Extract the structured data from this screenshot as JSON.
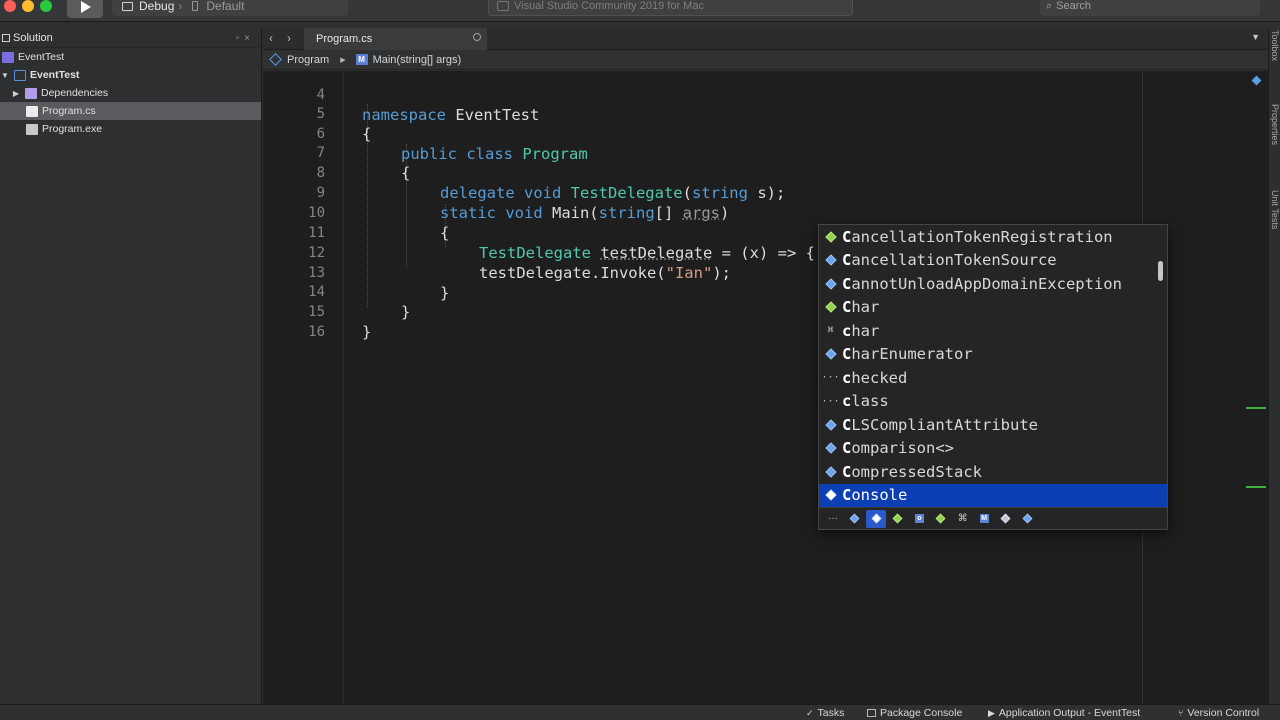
{
  "titlebar": {
    "configuration": "Debug",
    "target": "Default",
    "status_text": "Visual Studio Community 2019 for Mac",
    "search_placeholder": "Search"
  },
  "solution_pad": {
    "title": "Solution",
    "items": [
      {
        "label": "EventTest",
        "icon": "solution-icon"
      },
      {
        "label": "EventTest",
        "icon": "project-icon"
      },
      {
        "label": "Dependencies",
        "icon": "folder-icon"
      },
      {
        "label": "Program.cs",
        "icon": "csharp-file-icon",
        "selected": true
      },
      {
        "label": "Program.exe",
        "icon": "file-icon"
      }
    ]
  },
  "editor": {
    "tab_label": "Program.cs",
    "breadcrumb": {
      "class": "Program",
      "method": "Main(string[] args)"
    },
    "lines": [
      {
        "num": "4"
      },
      {
        "num": "5"
      },
      {
        "num": "6"
      },
      {
        "num": "7"
      },
      {
        "num": "8"
      },
      {
        "num": "9"
      },
      {
        "num": "10"
      },
      {
        "num": "11"
      },
      {
        "num": "12"
      },
      {
        "num": "13"
      },
      {
        "num": "14"
      },
      {
        "num": "15"
      },
      {
        "num": "16"
      }
    ],
    "code": {
      "l4_kw": "namespace",
      "l4_rest": " EventTest",
      "brace_open": "{",
      "brace_close": "}",
      "l6_kw": "public class ",
      "l6_ty": "Program",
      "l8_kw": "delegate void ",
      "l8_ty": "TestDelegate",
      "l8_p": "(",
      "l8_kw2": "string",
      "l8_rest": " s);",
      "l9_kw": "static void ",
      "l9_m": "Main(",
      "l9_kw2": "string",
      "l9_mid": "[] ",
      "l9_arg": "args",
      "l9_end": ")",
      "l11_ty": "TestDelegate",
      "l11_sp": " ",
      "l11_var": "testDelegate",
      "l11_rest": " = (x) => { C};",
      "l12_a": "testDelegate.Invoke(",
      "l12_str": "\"Ian\"",
      "l12_end": ");"
    }
  },
  "completion": {
    "items": [
      {
        "first": "C",
        "rest": "ancellationTokenRegistration",
        "icon": "struct-icon"
      },
      {
        "first": "C",
        "rest": "ancellationTokenSource",
        "icon": "class-icon"
      },
      {
        "first": "C",
        "rest": "annotUnloadAppDomainException",
        "icon": "class-icon"
      },
      {
        "first": "C",
        "rest": "har",
        "icon": "struct-icon"
      },
      {
        "first": "c",
        "rest": "har",
        "icon": "keyword-icon"
      },
      {
        "first": "C",
        "rest": "harEnumerator",
        "icon": "class-icon"
      },
      {
        "first": "c",
        "rest": "hecked",
        "icon": "snippet-icon"
      },
      {
        "first": "c",
        "rest": "lass",
        "icon": "snippet-icon"
      },
      {
        "first": "C",
        "rest": "LSCompliantAttribute",
        "icon": "class-icon"
      },
      {
        "first": "C",
        "rest": "omparison<>",
        "icon": "delegate-icon"
      },
      {
        "first": "C",
        "rest": "ompressedStack",
        "icon": "class-icon"
      },
      {
        "first": "C",
        "rest": "onsole",
        "icon": "class-icon",
        "selected": true
      }
    ]
  },
  "right_pads": [
    "Toolbox",
    "Properties",
    "Unit Tests"
  ],
  "bottom_pads": {
    "tasks": "Tasks",
    "package_console": "Package Console",
    "app_output": "Application Output - EventTest",
    "version_control": "Version Control"
  },
  "colors": {
    "keyword": "#569cd6",
    "type": "#4ec9b0",
    "string": "#d69d85",
    "selection": "#0b3fb3"
  }
}
